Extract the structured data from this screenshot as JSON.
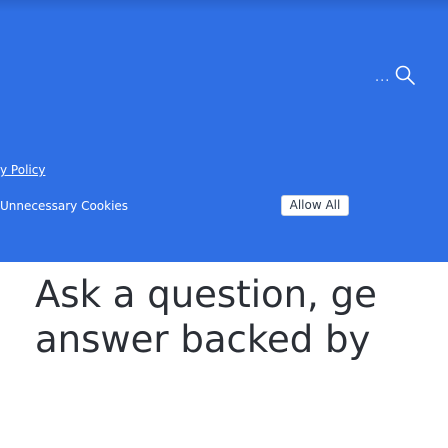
{
  "cookie_banner": {
    "policy_link": "y Policy",
    "deny_label": "Unnecessary Cookies",
    "allow_label": "Allow All",
    "more_label": "...",
    "search_icon": "search-icon"
  },
  "hero": {
    "line1": "Ask a question, ge",
    "line2": "answer backed by"
  },
  "colors": {
    "banner": "#2f6fe4",
    "headline": "#2b2f36"
  }
}
